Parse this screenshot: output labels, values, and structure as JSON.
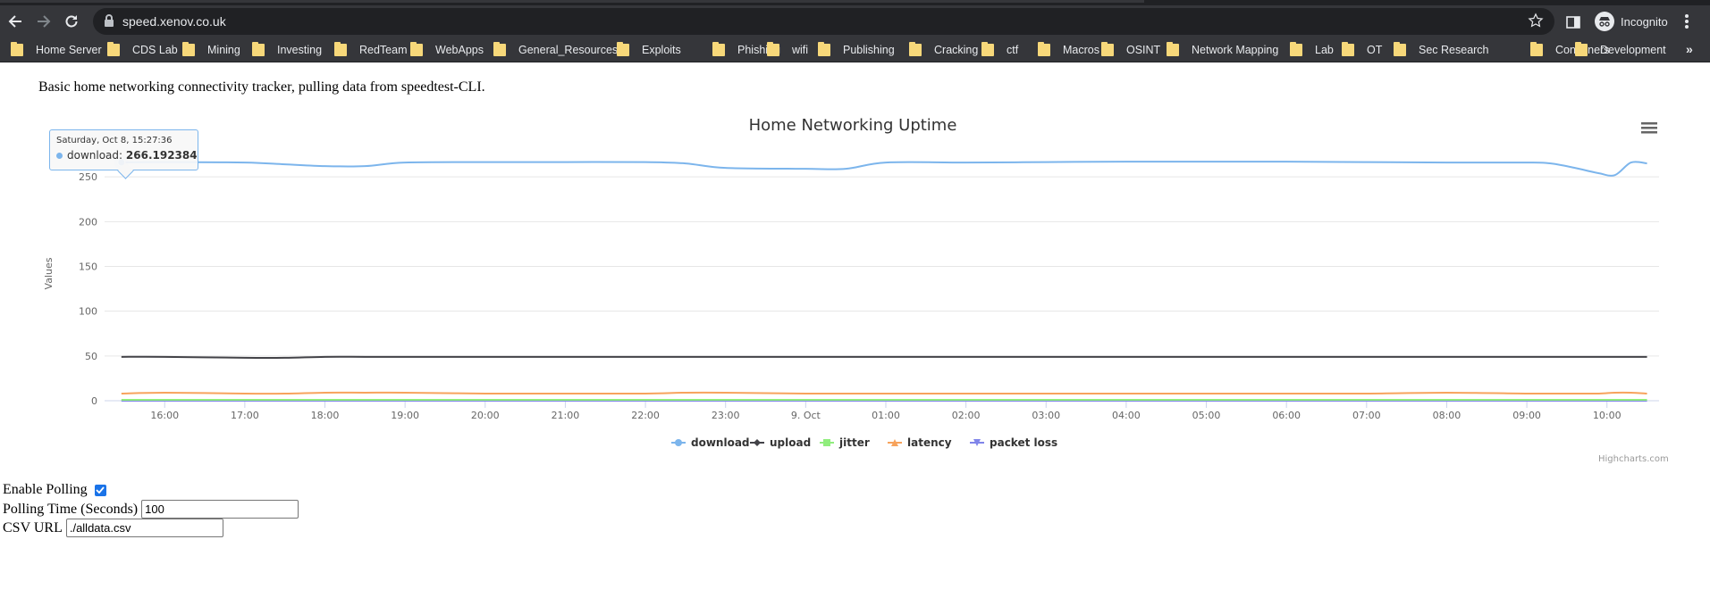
{
  "browser": {
    "url": "speed.xenov.co.uk",
    "incognito_label": "Incognito",
    "bookmarks": [
      "Home Server",
      "CDS Lab",
      "Mining",
      "Investing",
      "RedTeam",
      "WebApps",
      "General_Resources",
      "Exploits",
      "Phishing",
      "wifi",
      "Publishing",
      "Cracking",
      "ctf",
      "Macros",
      "OSINT",
      "Network Mapping",
      "Lab",
      "OT",
      "Sec Research",
      "Containers",
      "Development"
    ],
    "more_bookmarks": "»"
  },
  "page": {
    "intro": "Basic home networking connectivity tracker, pulling data from speedtest-CLI."
  },
  "chart_data": {
    "type": "line",
    "title": "Home Networking Uptime",
    "ylabel": "Values",
    "xlabel": "",
    "ylim": [
      0,
      300
    ],
    "y_ticks": [
      0,
      50,
      100,
      150,
      200,
      250
    ],
    "x_ticks": [
      "16:00",
      "17:00",
      "18:00",
      "19:00",
      "20:00",
      "21:00",
      "22:00",
      "23:00",
      "9. Oct",
      "01:00",
      "02:00",
      "03:00",
      "04:00",
      "05:00",
      "06:00",
      "07:00",
      "08:00",
      "09:00",
      "10:00"
    ],
    "x_range_hours": [
      15.25,
      34.65
    ],
    "x": [
      15.46,
      16.0,
      17.0,
      17.5,
      18.0,
      18.5,
      19.0,
      20.0,
      21.0,
      22.0,
      22.5,
      23.0,
      24.0,
      24.5,
      25.0,
      26.0,
      27.0,
      28.0,
      29.0,
      30.0,
      31.0,
      32.0,
      33.0,
      33.3,
      33.6,
      33.9,
      34.1,
      34.3,
      34.5
    ],
    "series": [
      {
        "name": "download",
        "color": "#7cb5ec",
        "values": [
          266.2,
          266.5,
          266,
          264,
          262,
          262,
          266,
          266.5,
          266.5,
          266.5,
          265,
          260,
          259,
          259,
          266,
          266,
          266.5,
          267,
          267,
          267,
          266.5,
          266,
          266,
          265,
          260,
          254,
          252,
          266,
          265
        ]
      },
      {
        "name": "upload",
        "color": "#434348",
        "values": [
          49,
          49,
          48,
          48,
          49,
          49,
          49,
          49,
          49,
          49,
          49,
          49,
          49,
          49,
          49,
          49,
          49,
          49,
          49,
          49,
          49,
          49,
          49,
          49,
          49,
          49,
          49,
          49,
          49
        ]
      },
      {
        "name": "jitter",
        "color": "#90ed7d",
        "values": [
          1,
          1,
          1,
          1,
          1,
          1,
          1,
          1,
          1,
          1,
          1,
          1,
          1,
          1,
          1,
          1,
          1,
          1,
          1,
          1,
          1,
          1,
          1,
          1,
          1,
          1,
          1,
          1,
          1
        ]
      },
      {
        "name": "latency",
        "color": "#f7a35c",
        "values": [
          8,
          9,
          8,
          8,
          9,
          9,
          9,
          8,
          8,
          8,
          9,
          9,
          8,
          8,
          8,
          8,
          8,
          8,
          8,
          8,
          8,
          9,
          8,
          8,
          8,
          8,
          9,
          9,
          8
        ]
      },
      {
        "name": "packet loss",
        "color": "#8085e9",
        "values": [
          0,
          0,
          0,
          0,
          0,
          0,
          0,
          0,
          0,
          0,
          0,
          0,
          0,
          0,
          0,
          0,
          0,
          0,
          0,
          0,
          0,
          0,
          0,
          0,
          0,
          0,
          0,
          0,
          0
        ]
      }
    ],
    "legend_placement": "bottom-center",
    "grid": true,
    "tooltip": {
      "date": "Saturday, Oct 8, 15:27:36",
      "series": "download",
      "value": "266.192384"
    },
    "credits": "Highcharts.com"
  },
  "form": {
    "polling_label": "Enable Polling",
    "polling_checked": true,
    "polling_time_label": "Polling Time (Seconds)",
    "polling_time_value": "100",
    "csv_label": "CSV URL",
    "csv_value": "./alldata.csv"
  }
}
